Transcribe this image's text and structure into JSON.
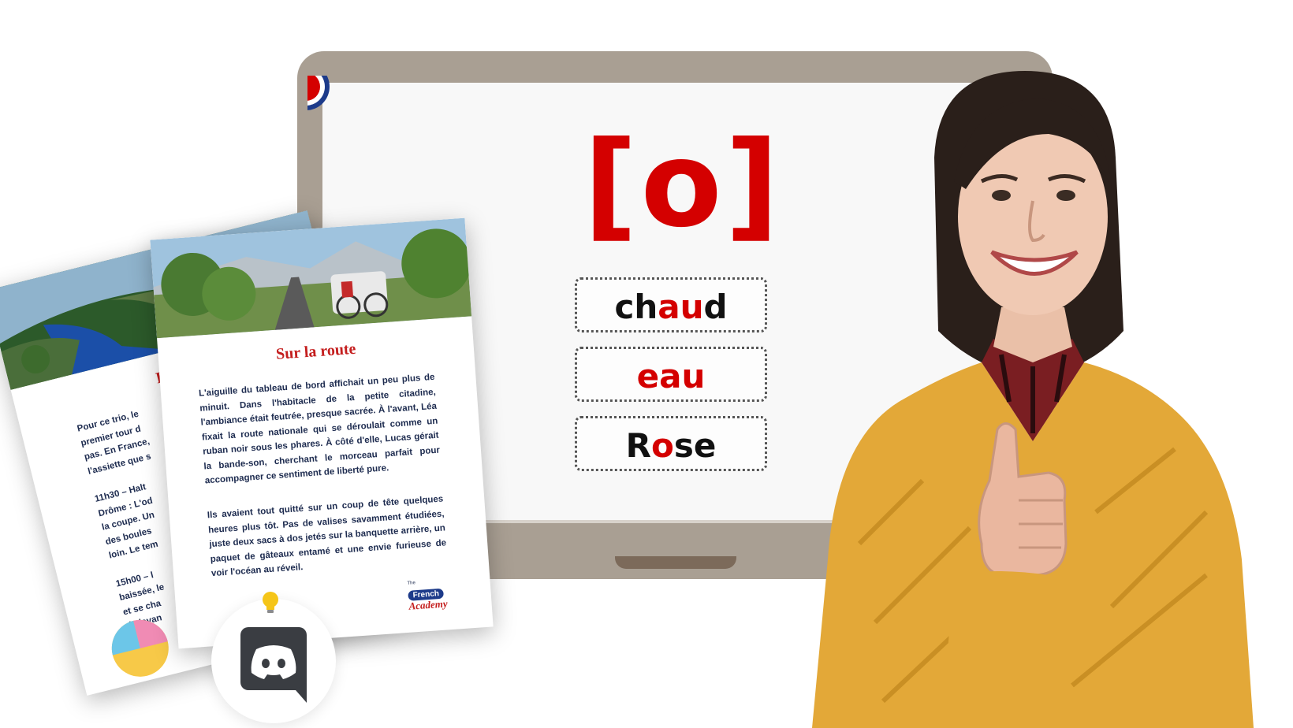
{
  "slide": {
    "phoneme": "[o]",
    "words": [
      {
        "before": "ch",
        "highlight": "au",
        "after": "d"
      },
      {
        "before": "",
        "highlight": "eau",
        "after": ""
      },
      {
        "before": "R",
        "highlight": "o",
        "after": "se"
      }
    ]
  },
  "documents": {
    "back": {
      "heading": "Les va",
      "lines": [
        "Pour ce trio, le",
        "premier tour d",
        "pas. En France,",
        "l'assiette que s",
        "",
        "11h30 – Halt",
        "Drôme : L'od",
        "la coupe. Un",
        "des boules",
        "loin. Le tem",
        "",
        "15h00 – l",
        "baissée, le",
        "et se cha",
        "de lavan"
      ]
    },
    "front": {
      "heading": "Sur la route",
      "paragraph1": "L'aiguille du tableau de bord affichait un peu plus de minuit. Dans l'habitacle de la petite citadine, l'ambiance était feutrée, presque sacrée. À l'avant, Léa fixait la route nationale qui se déroulait comme un ruban noir sous les phares. À côté d'elle, Lucas gérait la bande-son, cherchant le morceau parfait pour accompagner ce sentiment de liberté pure.",
      "paragraph2": "Ils avaient tout quitté sur un coup de tête quelques heures plus tôt. Pas de valises savamment étudiées, juste deux sacs à dos jetés sur la banquette arrière, un paquet de gâteaux entamé et une envie furieuse de voir l'océan au réveil.",
      "logo_small": "The",
      "logo_main": "French",
      "logo_script": "Academy"
    }
  },
  "colors": {
    "accent_red": "#d40000",
    "monitor_frame": "#a99f93",
    "discord_gray": "#3a3d42",
    "sweater": "#e3a838"
  },
  "icons": [
    "discord-icon",
    "lightbulb-icon",
    "beach-ball-icon",
    "french-flag-icon"
  ]
}
